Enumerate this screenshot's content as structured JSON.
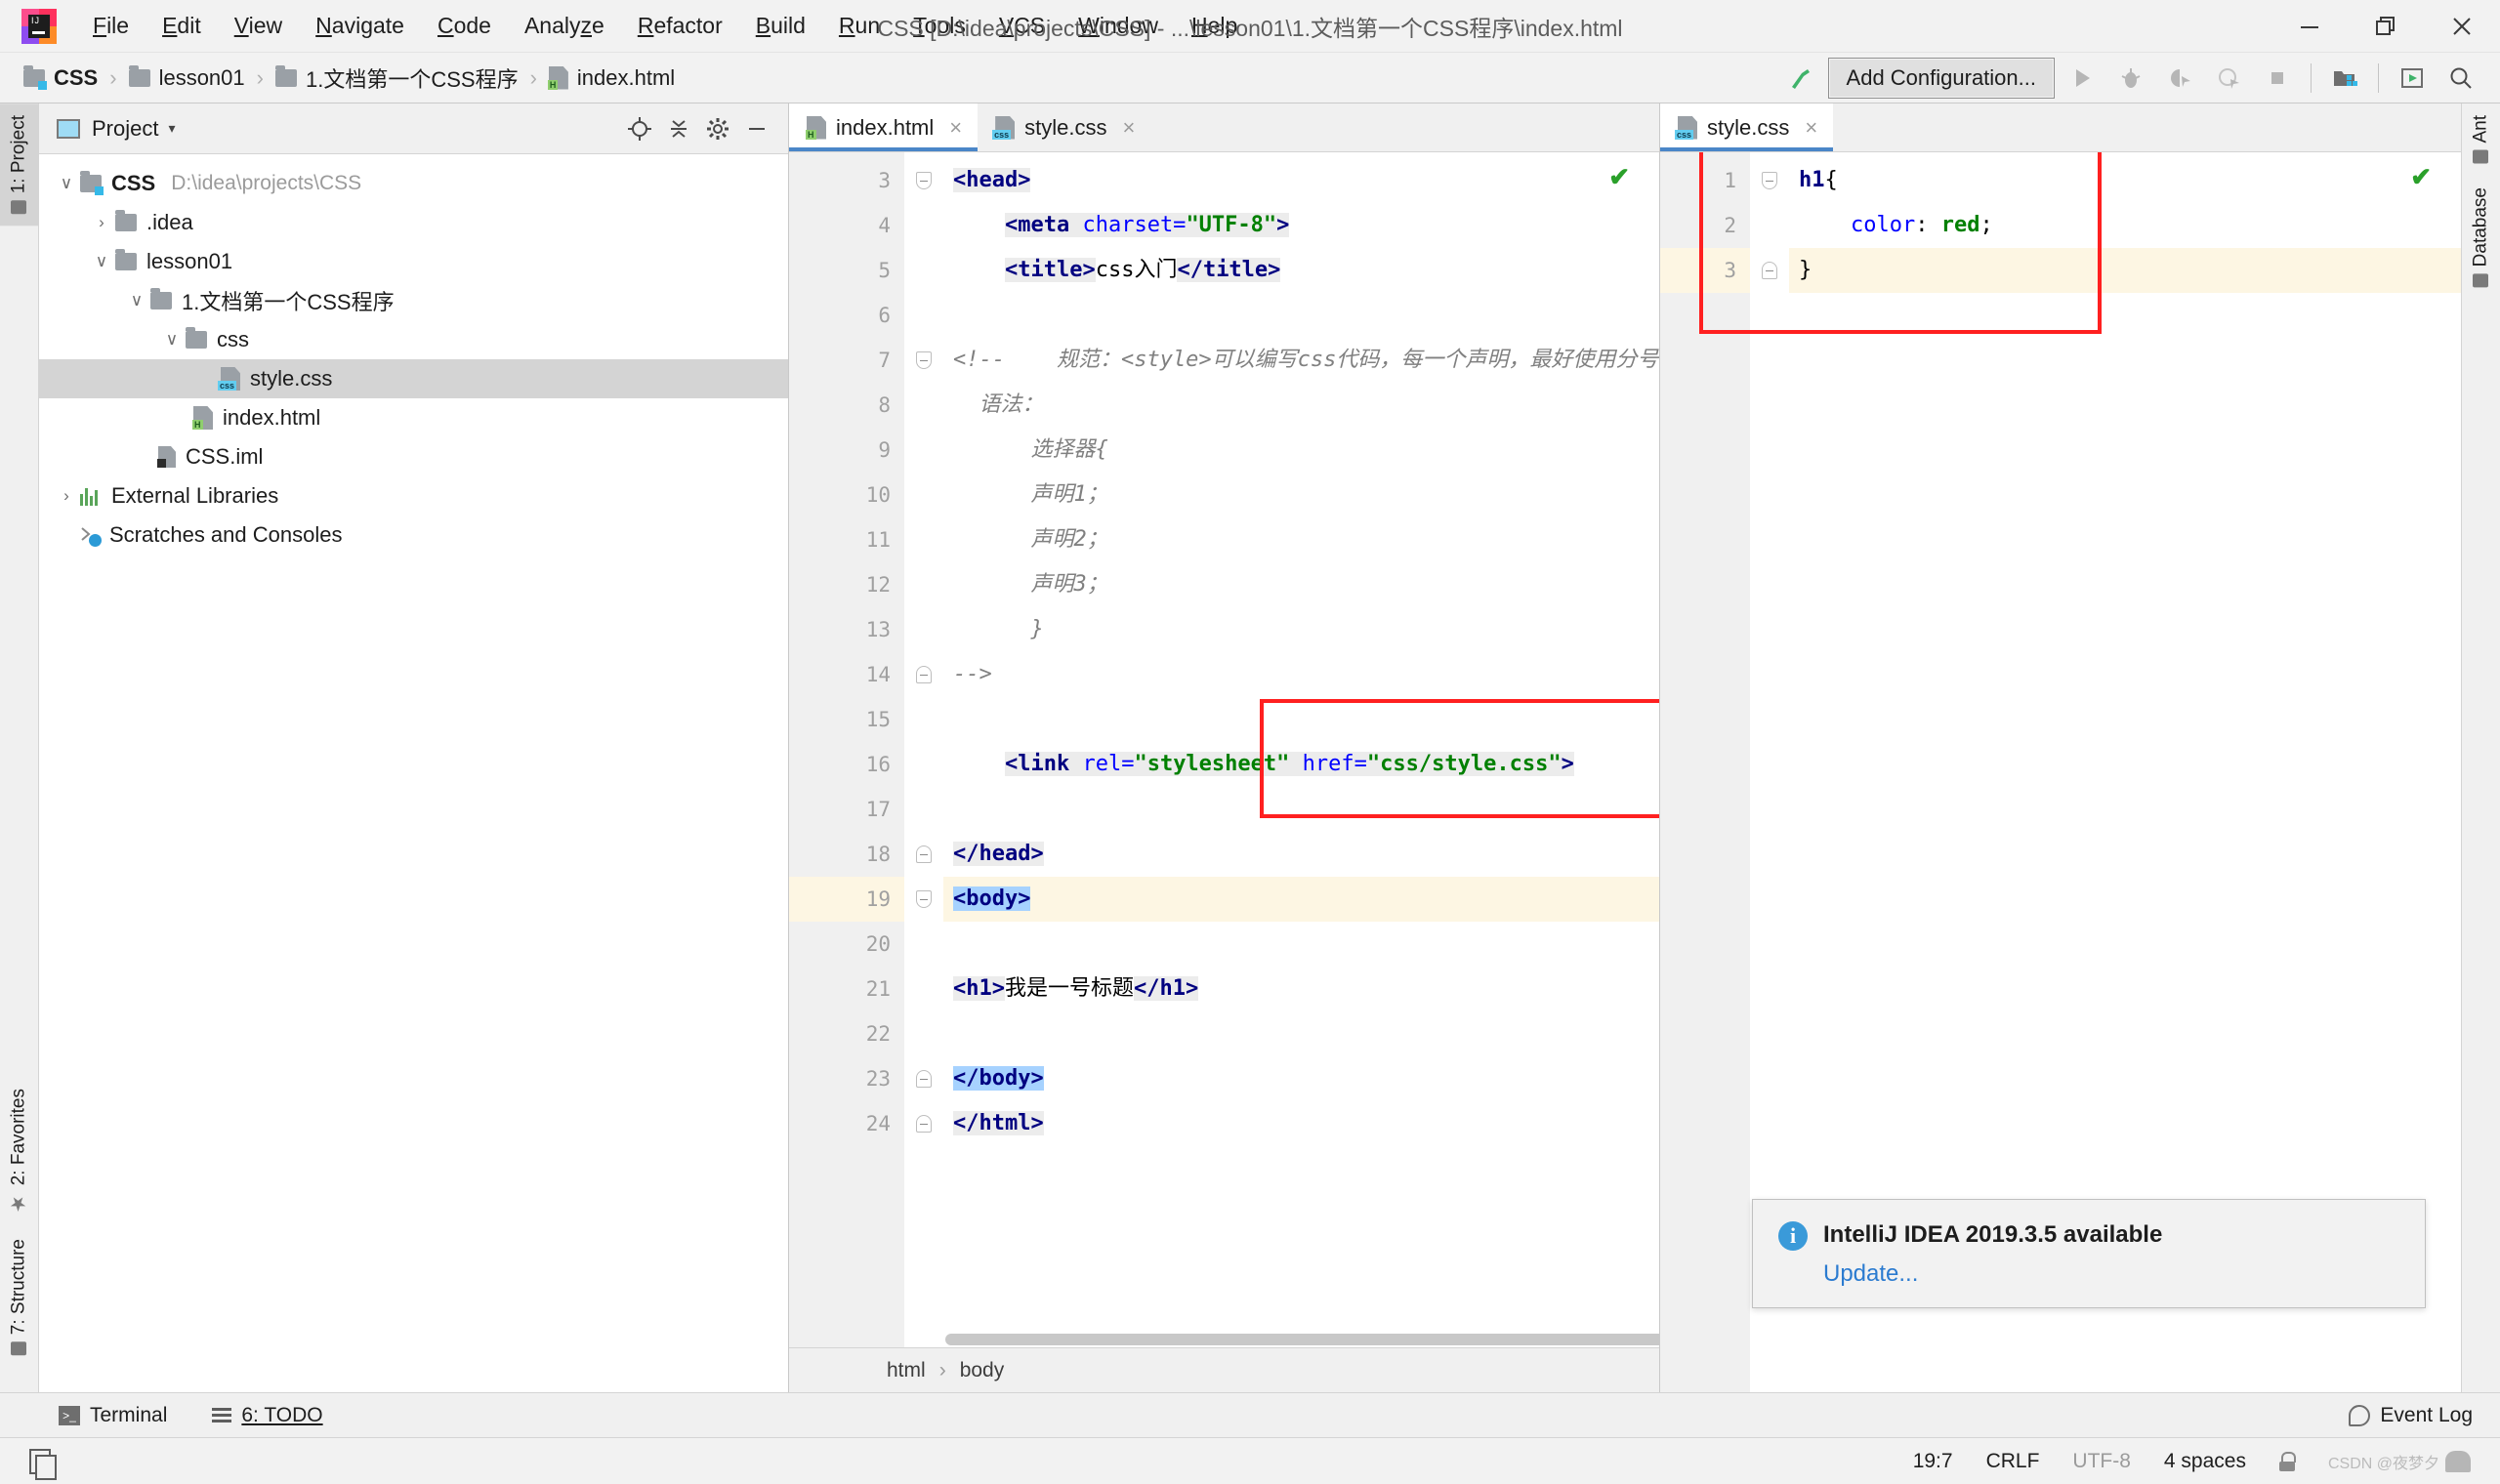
{
  "window": {
    "title": "CSS [D:\\idea\\projects\\CSS] - ...\\lesson01\\1.文档第一个CSS程序\\index.html",
    "minimize_label": "Minimize",
    "maximize_label": "Restore",
    "close_label": "Close"
  },
  "menubar": [
    {
      "label": "File",
      "mnemonic": "F"
    },
    {
      "label": "Edit",
      "mnemonic": "E"
    },
    {
      "label": "View",
      "mnemonic": "V"
    },
    {
      "label": "Navigate",
      "mnemonic": "N"
    },
    {
      "label": "Code",
      "mnemonic": "C"
    },
    {
      "label": "Analyze",
      "mnemonic": "z"
    },
    {
      "label": "Refactor",
      "mnemonic": "R"
    },
    {
      "label": "Build",
      "mnemonic": "B"
    },
    {
      "label": "Run",
      "mnemonic": "R"
    },
    {
      "label": "Tools",
      "mnemonic": "T"
    },
    {
      "label": "VCS",
      "mnemonic": "V"
    },
    {
      "label": "Window",
      "mnemonic": "W"
    },
    {
      "label": "Help",
      "mnemonic": "H"
    }
  ],
  "navbar": {
    "breadcrumbs": [
      {
        "label": "CSS",
        "icon": "project-folder-icon"
      },
      {
        "label": "lesson01",
        "icon": "folder-icon"
      },
      {
        "label": "1.文档第一个CSS程序",
        "icon": "folder-icon"
      },
      {
        "label": "index.html",
        "icon": "html-file-icon"
      }
    ],
    "separator": "›",
    "add_configuration_label": "Add Configuration...",
    "icons": [
      "build-hammer-icon",
      "run-icon",
      "debug-icon",
      "run-coverage-icon",
      "profile-icon",
      "stop-icon",
      "project-structure-icon",
      "update-icon",
      "search-everywhere-icon"
    ]
  },
  "left_rail": {
    "tabs": [
      {
        "label": "1: Project",
        "active": true
      },
      {
        "label": "2: Favorites",
        "active": false
      },
      {
        "label": "7: Structure",
        "active": false
      }
    ]
  },
  "right_rail": {
    "tabs": [
      {
        "label": "Ant",
        "active": false
      },
      {
        "label": "Database",
        "active": false
      }
    ]
  },
  "project_panel": {
    "title": "Project",
    "caret": "▾",
    "header_icons": [
      "locate-icon",
      "collapse-all-icon",
      "gear-icon",
      "hide-icon"
    ],
    "tree": [
      {
        "label": "CSS",
        "path": "D:\\idea\\projects\\CSS",
        "depth": 0,
        "twisty": "∨",
        "icon": "project-folder-icon",
        "bold": true,
        "selected": false
      },
      {
        "label": ".idea",
        "path": "",
        "depth": 1,
        "twisty": "›",
        "icon": "folder-icon",
        "bold": false,
        "selected": false
      },
      {
        "label": "lesson01",
        "path": "",
        "depth": 1,
        "twisty": "∨",
        "icon": "folder-icon",
        "bold": false,
        "selected": false
      },
      {
        "label": "1.文档第一个CSS程序",
        "path": "",
        "depth": 2,
        "twisty": "∨",
        "icon": "folder-icon",
        "bold": false,
        "selected": false
      },
      {
        "label": "css",
        "path": "",
        "depth": 3,
        "twisty": "∨",
        "icon": "folder-icon",
        "bold": false,
        "selected": false
      },
      {
        "label": "style.css",
        "path": "",
        "depth": 4,
        "twisty": "",
        "icon": "css-file-icon",
        "bold": false,
        "selected": true
      },
      {
        "label": "index.html",
        "path": "",
        "depth": 3,
        "twisty": "",
        "icon": "html-file-icon",
        "bold": false,
        "selected": false
      },
      {
        "label": "CSS.iml",
        "path": "",
        "depth": 2,
        "twisty": "",
        "icon": "iml-file-icon",
        "bold": false,
        "selected": false
      },
      {
        "label": "External Libraries",
        "path": "",
        "depth": 0,
        "twisty": "›",
        "icon": "libraries-icon",
        "bold": false,
        "selected": false
      },
      {
        "label": "Scratches and Consoles",
        "path": "",
        "depth": 0,
        "twisty": "",
        "icon": "scratches-icon",
        "bold": false,
        "selected": false
      }
    ]
  },
  "editor_left": {
    "tabs": [
      {
        "label": "index.html",
        "icon": "html-file-icon",
        "active": true,
        "close": "×"
      },
      {
        "label": "style.css",
        "icon": "css-file-icon",
        "active": false,
        "close": "×"
      }
    ],
    "inspection_ok": "✔",
    "first_visible_line": 3,
    "lines": [
      {
        "n": 3,
        "html": "<span class=\"seg tok-tag\">&lt;head&gt;</span>",
        "fold": "down",
        "highlight": false
      },
      {
        "n": 4,
        "html": "    <span class=\"seg\"><span class=\"tok-tag\">&lt;meta </span><span class=\"tok-attr\">charset=</span><span class=\"tok-val\">\"UTF-8\"</span><span class=\"tok-tag\">&gt;</span></span>",
        "fold": "",
        "highlight": false
      },
      {
        "n": 5,
        "html": "    <span class=\"seg tok-tag\">&lt;title&gt;</span><span class=\"tok-txt\">css入门</span><span class=\"seg tok-tag\">&lt;/title&gt;</span>",
        "fold": "",
        "highlight": false
      },
      {
        "n": 6,
        "html": "",
        "fold": "",
        "highlight": false
      },
      {
        "n": 7,
        "html": "<span class=\"tok-cmt\">&lt;!--    规范：&lt;style&gt;可以编写css代码，每一个声明，最好使用分号</span>",
        "fold": "down",
        "highlight": false
      },
      {
        "n": 8,
        "html": "<span class=\"tok-cmt\">  语法：</span>",
        "fold": "",
        "highlight": false
      },
      {
        "n": 9,
        "html": "<span class=\"tok-cmt\">      选择器{</span>",
        "fold": "",
        "highlight": false
      },
      {
        "n": 10,
        "html": "<span class=\"tok-cmt\">      声明1；</span>",
        "fold": "",
        "highlight": false
      },
      {
        "n": 11,
        "html": "<span class=\"tok-cmt\">      声明2；</span>",
        "fold": "",
        "highlight": false
      },
      {
        "n": 12,
        "html": "<span class=\"tok-cmt\">      声明3；</span>",
        "fold": "",
        "highlight": false
      },
      {
        "n": 13,
        "html": "<span class=\"tok-cmt\">      }</span>",
        "fold": "",
        "highlight": false
      },
      {
        "n": 14,
        "html": "<span class=\"tok-cmt\">--&gt;</span>",
        "fold": "up",
        "highlight": false
      },
      {
        "n": 15,
        "html": "",
        "fold": "",
        "highlight": false
      },
      {
        "n": 16,
        "html": "    <span class=\"seg\"><span class=\"tok-tag\">&lt;link </span><span class=\"tok-attr\">rel=</span><span class=\"tok-val\">\"stylesheet\"</span><span class=\"tok-tag\"> </span><span class=\"tok-attr\">href=</span><span class=\"tok-val\">\"css/style.css\"</span><span class=\"tok-tag\">&gt;</span></span>",
        "fold": "",
        "highlight": false
      },
      {
        "n": 17,
        "html": "",
        "fold": "",
        "highlight": false
      },
      {
        "n": 18,
        "html": "<span class=\"seg tok-tag\">&lt;/head&gt;</span>",
        "fold": "up",
        "highlight": false
      },
      {
        "n": 19,
        "html": "<span class=\"sel tok-tag\">&lt;body&gt;</span>",
        "fold": "down",
        "highlight": true
      },
      {
        "n": 20,
        "html": "",
        "fold": "",
        "highlight": false
      },
      {
        "n": 21,
        "html": "<span class=\"seg tok-tag\">&lt;h1&gt;</span><span class=\"tok-txt\">我是一号标题</span><span class=\"seg tok-tag\">&lt;/h1&gt;</span>",
        "fold": "",
        "highlight": false
      },
      {
        "n": 22,
        "html": "",
        "fold": "",
        "highlight": false
      },
      {
        "n": 23,
        "html": "<span class=\"sel tok-tag\">&lt;/body&gt;</span>",
        "fold": "up",
        "highlight": false
      },
      {
        "n": 24,
        "html": "<span class=\"seg tok-tag\">&lt;/html&gt;</span>",
        "fold": "up",
        "highlight": false
      }
    ],
    "bottom_breadcrumb": [
      "html",
      "body"
    ],
    "bottom_breadcrumb_sep": "›"
  },
  "editor_right": {
    "tabs": [
      {
        "label": "style.css",
        "icon": "css-file-icon",
        "active": true,
        "close": "×"
      }
    ],
    "inspection_ok": "✔",
    "color_swatch": "#ff0000",
    "lines": [
      {
        "n": 1,
        "html": "<span class=\"tok-tag\">h1</span><span class=\"tok-txt\">{</span>",
        "fold": "down",
        "highlight": false,
        "swatch": false
      },
      {
        "n": 2,
        "html": "    <span class=\"tok-attr\">color</span><span class=\"tok-txt\">: </span><span class=\"tok-val\">red</span><span class=\"tok-txt\">;</span>",
        "fold": "",
        "highlight": false,
        "swatch": true
      },
      {
        "n": 3,
        "html": "<span class=\"tok-txt\">}</span>",
        "fold": "up",
        "highlight": true,
        "swatch": false
      }
    ]
  },
  "notification": {
    "icon": "info-icon",
    "message": "IntelliJ IDEA 2019.3.5 available",
    "link": "Update..."
  },
  "toolwindow_bar": {
    "items": [
      {
        "label": "Terminal",
        "icon": "terminal-icon"
      },
      {
        "label": "6: TODO",
        "icon": "todo-list-icon"
      }
    ],
    "event_log": {
      "label": "Event Log",
      "icon": "event-log-icon"
    }
  },
  "statusbar": {
    "caret_position": "19:7",
    "line_separator": "CRLF",
    "encoding": "UTF-8",
    "indent": "4 spaces",
    "lock_icon": "lock-icon",
    "doc_icon": "document-icon",
    "watermark": "CSDN @夜梦夕"
  },
  "colors": {
    "accent": "#4a86c8",
    "highlight_box": "#ff2020",
    "selection": "#a6d2ff",
    "current_line": "#fdf6e3",
    "red_value": "#ff0000"
  }
}
